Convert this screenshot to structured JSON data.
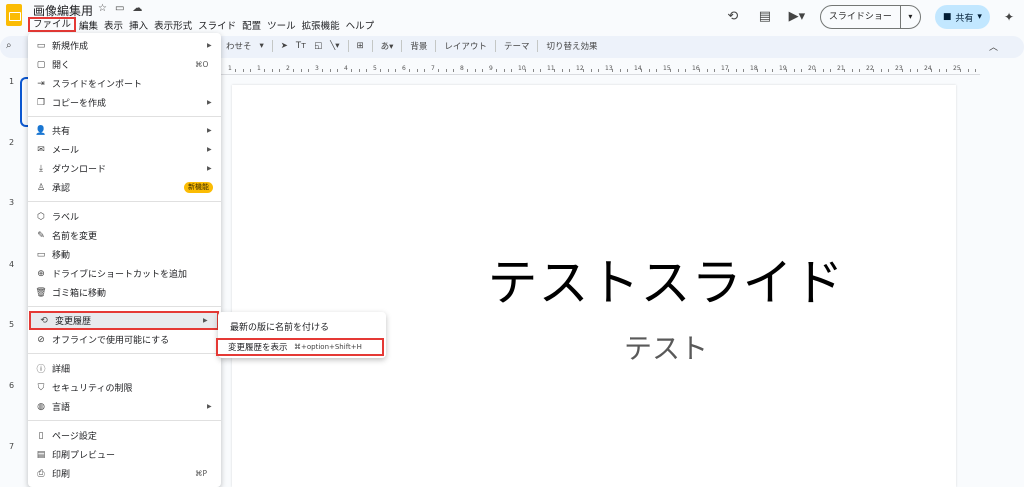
{
  "header": {
    "doc_title": "画像編集用",
    "menus": [
      "ファイル",
      "編集",
      "表示",
      "挿入",
      "表示形式",
      "スライド",
      "配置",
      "ツール",
      "拡張機能",
      "ヘルプ"
    ],
    "slideshow_label": "スライドショー",
    "share_label": "共有"
  },
  "toolbar": {
    "fit_label": "わせそ",
    "background": "背景",
    "layout": "レイアウト",
    "theme": "テーマ",
    "transition": "切り替え効果"
  },
  "ruler": [
    "1",
    "1",
    "2",
    "3",
    "4",
    "5",
    "6",
    "7",
    "8",
    "9",
    "10",
    "11",
    "12",
    "13",
    "14",
    "15",
    "16",
    "17",
    "18",
    "19",
    "20",
    "21",
    "22",
    "23",
    "24",
    "25"
  ],
  "filmstrip": [
    "1",
    "2",
    "3",
    "4",
    "5",
    "6",
    "7"
  ],
  "slide": {
    "title": "テストスライド",
    "subtitle": "テスト"
  },
  "file_menu": {
    "new": "新規作成",
    "open": "開く",
    "open_shortcut": "⌘O",
    "import": "スライドをインポート",
    "copy": "コピーを作成",
    "share": "共有",
    "email": "メール",
    "download": "ダウンロード",
    "approval": "承認",
    "approval_badge": "新機能",
    "label": "ラベル",
    "rename": "名前を変更",
    "move": "移動",
    "shortcut": "ドライブにショートカットを追加",
    "trash": "ゴミ箱に移動",
    "history": "変更履歴",
    "offline": "オフラインで使用可能にする",
    "details": "詳細",
    "security": "セキュリティの制限",
    "language": "言語",
    "page_setup": "ページ設定",
    "print_preview": "印刷プレビュー",
    "print": "印刷",
    "print_shortcut": "⌘P"
  },
  "history_submenu": {
    "name_version": "最新の版に名前を付ける",
    "show_history": "変更履歴を表示",
    "show_history_shortcut": "⌘+option+Shift+H"
  },
  "colors": {
    "highlight": "#e53935",
    "accent": "#0b57d0",
    "share_bg": "#c2e7ff",
    "badge": "#fbbc04"
  }
}
